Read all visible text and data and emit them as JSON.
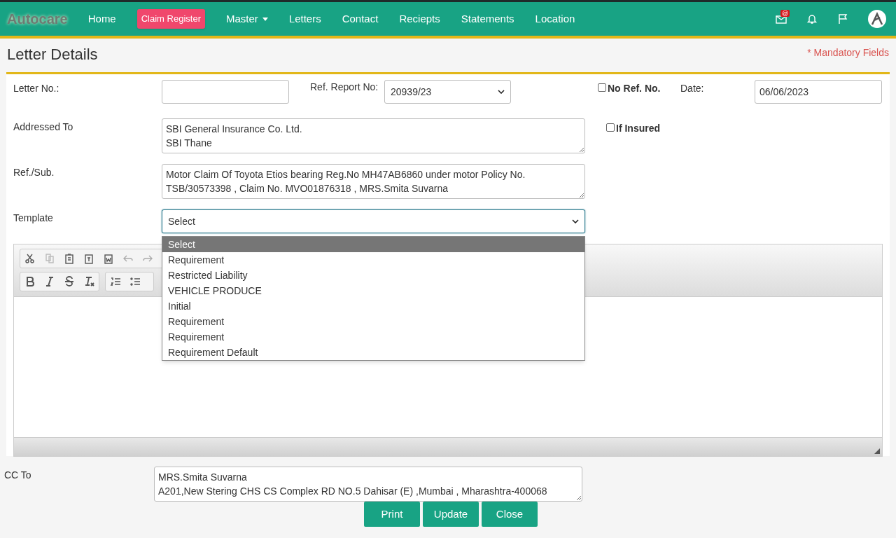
{
  "navbar": {
    "brand": "Autocare",
    "items": [
      {
        "label": "Home",
        "kind": "link"
      },
      {
        "label": "Claim Register",
        "kind": "badge"
      },
      {
        "label": "Master",
        "kind": "dropdown"
      },
      {
        "label": "Letters",
        "kind": "link"
      },
      {
        "label": "Contact",
        "kind": "link"
      },
      {
        "label": "Reciepts",
        "kind": "link"
      },
      {
        "label": "Statements",
        "kind": "link"
      },
      {
        "label": "Location",
        "kind": "link"
      }
    ],
    "mail_badge": "@"
  },
  "page": {
    "title": "Letter Details",
    "mandatory_note": "* Mandatory Fields"
  },
  "form": {
    "letter_no": {
      "label": "Letter No.:"
    },
    "ref_report": {
      "label": "Ref. Report No:",
      "value": "20939/23"
    },
    "no_ref": {
      "label": "No Ref. No.",
      "checked": false
    },
    "date": {
      "label": "Date:",
      "value": "06/06/2023"
    },
    "addressed_to": {
      "label": "Addressed To",
      "lines": [
        "SBI General Insurance Co. Ltd.",
        "SBI Thane"
      ]
    },
    "if_insured": {
      "label": "If Insured",
      "checked": false
    },
    "ref_sub": {
      "label": "Ref./Sub.",
      "lines": [
        "Motor Claim Of Toyota Etios bearing Reg.No MH47AB6860 under motor Policy No.",
        "TSB/30573398 , Claim No. MVO01876318 , MRS.Smita Suvarna"
      ]
    },
    "template": {
      "label": "Template",
      "value": "Select",
      "expanded": true,
      "options": [
        {
          "label": "Select",
          "selected": true
        },
        {
          "label": "Requirement",
          "selected": false
        },
        {
          "label": "Restricted Liability",
          "selected": false
        },
        {
          "label": "VEHICLE PRODUCE",
          "selected": false
        },
        {
          "label": "Initial",
          "selected": false
        },
        {
          "label": "Requirement",
          "selected": false
        },
        {
          "label": "Requirement",
          "selected": false
        },
        {
          "label": "Requirement Default",
          "selected": false
        }
      ]
    },
    "cc_to": {
      "label": "CC To",
      "lines": [
        "MRS.Smita Suvarna",
        "A201,New Stering CHS CS Complex RD NO.5 Dahisar (E) ,Mumbai , Mharashtra-400068"
      ]
    }
  },
  "buttons": [
    "Print",
    "Update",
    "Close"
  ]
}
